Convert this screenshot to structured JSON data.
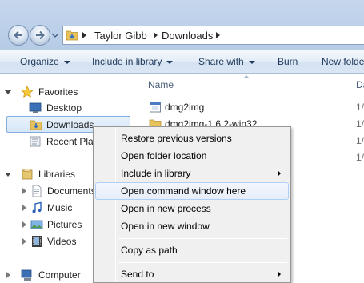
{
  "address": {
    "crumbs": [
      "Taylor Gibb",
      "Downloads"
    ]
  },
  "toolbar": {
    "organize": "Organize",
    "include_in_library": "Include in library",
    "share_with": "Share with",
    "burn": "Burn",
    "new_folder": "New folde"
  },
  "navpane": {
    "favorites": "Favorites",
    "desktop": "Desktop",
    "downloads": "Downloads",
    "recent_places": "Recent Plac",
    "libraries": "Libraries",
    "documents": "Documents",
    "music": "Music",
    "pictures": "Pictures",
    "videos": "Videos",
    "computer": "Computer"
  },
  "filelist": {
    "col_name": "Name",
    "col_date": "Da",
    "files": [
      {
        "name": "dmg2img",
        "date": "1/"
      },
      {
        "name": "dmg2img-1.6.2-win32",
        "date": "1/"
      },
      {
        "name": "",
        "date": "1/"
      },
      {
        "name": "",
        "date": "1/"
      }
    ]
  },
  "context_menu": {
    "items": [
      {
        "label": "Restore previous versions"
      },
      {
        "label": "Open folder location"
      },
      {
        "label": "Include in library"
      },
      {
        "label": "Open command window here"
      },
      {
        "label": "Open in new process"
      },
      {
        "label": "Open in new window"
      },
      {
        "label": "Copy as path"
      },
      {
        "label": "Send to"
      }
    ]
  },
  "colors": {
    "accent": "#1e395b",
    "selection_border": "#84acdd",
    "menu_hover_border": "#aecff7"
  }
}
